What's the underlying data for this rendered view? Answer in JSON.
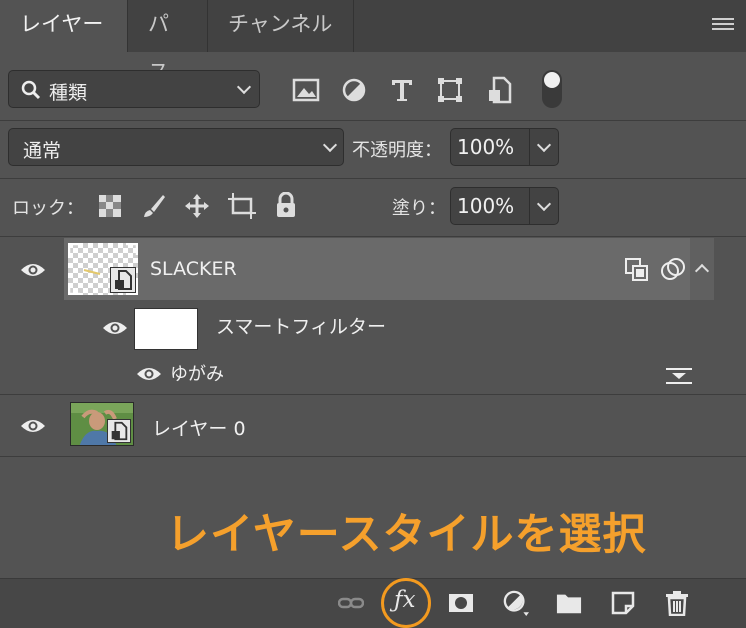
{
  "tabs": [
    {
      "label": "レイヤー",
      "active": true
    },
    {
      "label": "パス",
      "active": false
    },
    {
      "label": "チャンネル",
      "active": false
    }
  ],
  "filter": {
    "kind_label": "種類",
    "icons": [
      "image-filter-icon",
      "adjustment-filter-icon",
      "type-filter-icon",
      "shape-filter-icon",
      "smart-object-filter-icon"
    ]
  },
  "blend": {
    "mode": "通常",
    "opacity_label": "不透明度：",
    "opacity_value": "100%"
  },
  "lock": {
    "label": "ロック：",
    "fill_label": "塗り：",
    "fill_value": "100%"
  },
  "layers": {
    "slacker": {
      "name": "SLACKER"
    },
    "smart_filter": {
      "label": "スマートフィルター",
      "filter_name": "ゆがみ"
    },
    "layer0": {
      "name": "レイヤー 0"
    }
  },
  "annotation": "レイヤースタイルを選択",
  "bottom": {
    "fx_label": "ƒx"
  },
  "colors": {
    "accent": "#f39a1f",
    "panel": "#535353",
    "selected_layer": "#6a6a6a"
  }
}
